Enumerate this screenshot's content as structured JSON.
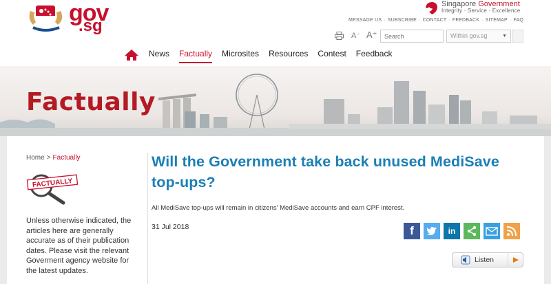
{
  "brand": {
    "logo_primary": "gov",
    "logo_secondary": ".sg",
    "gov_title_a": "Singapore ",
    "gov_title_b": "Government",
    "gov_tagline": "Integrity · Service · Excellence",
    "accent_color": "#c8102e"
  },
  "utility_links": [
    "MESSAGE US",
    "SUBSCRIBE",
    "CONTACT",
    "FEEDBACK",
    "SITEMAP",
    "FAQ"
  ],
  "tools": {
    "font_decrease": "A⁻",
    "font_increase": "A⁺",
    "search_placeholder": "Search",
    "scope_value": "Within gov.sg"
  },
  "nav": {
    "items": [
      {
        "label": "News"
      },
      {
        "label": "Factually"
      },
      {
        "label": "Microsites"
      },
      {
        "label": "Resources"
      },
      {
        "label": "Contest"
      },
      {
        "label": "Feedback"
      }
    ],
    "active": "Factually"
  },
  "banner": {
    "title": "Factually"
  },
  "breadcrumb": {
    "home": "Home",
    "separator": ">",
    "current": "Factually"
  },
  "badge": {
    "text": "FACTUALLY"
  },
  "sidebar_note": "Unless otherwise indicated, the articles here are generally accurate as of their publication dates. Please visit the relevant Goverment agency website for the latest updates.",
  "article": {
    "title": "Will the Government take back unused MediSave top-ups?",
    "summary": "All MediSave top-ups will remain in citizens' MediSave accounts and earn CPF interest.",
    "date": "31 Jul 2018"
  },
  "share": [
    {
      "icon": "facebook-icon",
      "glyph": "f"
    },
    {
      "icon": "twitter-icon",
      "glyph": "🐦"
    },
    {
      "icon": "linkedin-icon",
      "glyph": "in"
    },
    {
      "icon": "share-icon",
      "glyph": "<"
    },
    {
      "icon": "email-icon",
      "glyph": "✉"
    },
    {
      "icon": "rss-icon",
      "glyph": "))"
    }
  ],
  "listen": {
    "label": "Listen"
  }
}
